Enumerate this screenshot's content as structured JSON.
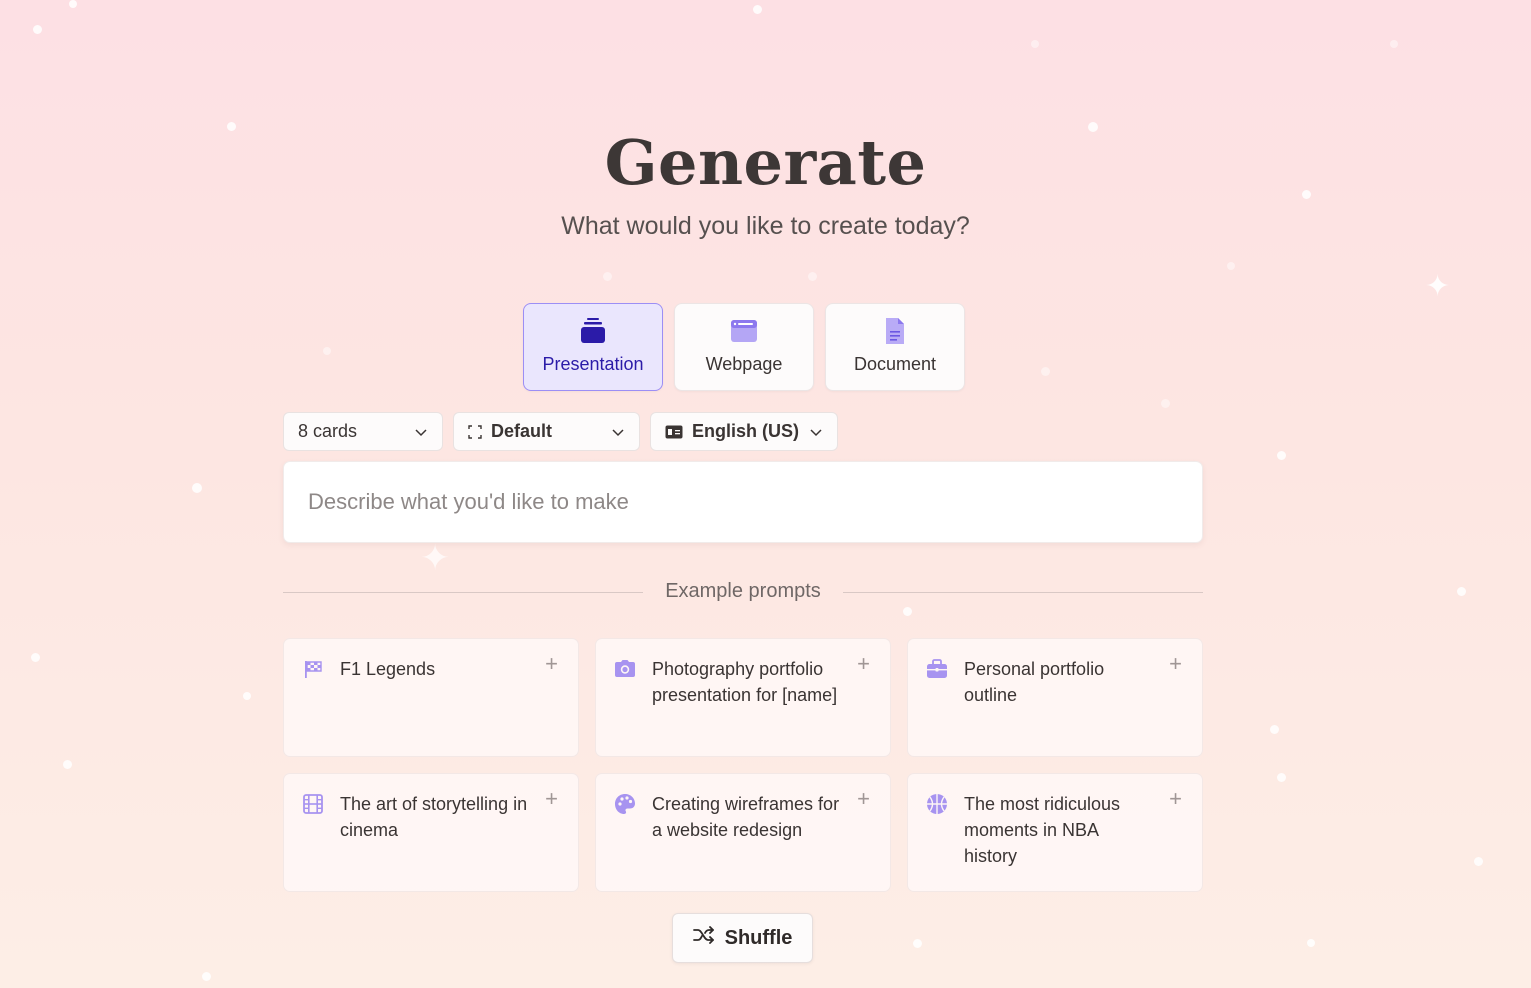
{
  "header": {
    "title": "Generate",
    "subtitle": "What would you like to create today?"
  },
  "content_types": [
    {
      "label": "Presentation",
      "icon": "stack-icon",
      "active": true
    },
    {
      "label": "Webpage",
      "icon": "browser-window-icon",
      "active": false
    },
    {
      "label": "Document",
      "icon": "document-icon",
      "active": false
    }
  ],
  "controls": {
    "cards": "8 cards",
    "format": "Default",
    "language": "English (US)"
  },
  "prompt": {
    "placeholder": "Describe what you'd like to make",
    "value": ""
  },
  "examples": {
    "heading": "Example prompts",
    "items": [
      {
        "text": "F1 Legends",
        "icon": "checkered-flag-icon"
      },
      {
        "text": "Photography portfolio presentation for [name]",
        "icon": "camera-icon"
      },
      {
        "text": "Personal portfolio outline",
        "icon": "briefcase-icon"
      },
      {
        "text": "The art of storytelling in cinema",
        "icon": "film-icon"
      },
      {
        "text": "Creating wireframes for a website redesign",
        "icon": "palette-icon"
      },
      {
        "text": "The most ridiculous moments in NBA history",
        "icon": "basketball-icon"
      }
    ],
    "add_symbol": "+"
  },
  "shuffle": {
    "label": "Shuffle",
    "icon": "shuffle-icon"
  },
  "colors": {
    "accent": "#2b1ba8",
    "accent_icon": "#a793f0",
    "active_bg": "#eae6fd",
    "active_border": "#9c8ef5"
  }
}
